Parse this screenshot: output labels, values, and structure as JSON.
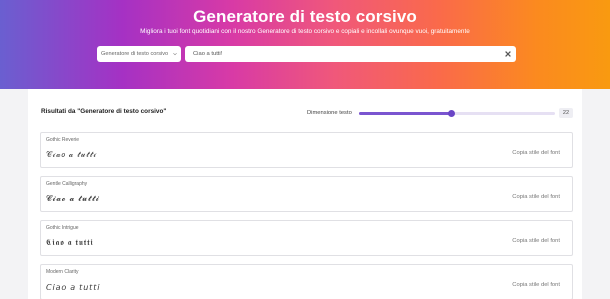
{
  "hero": {
    "title": "Generatore di testo corsivo",
    "subtitle": "Migliora i tuoi font quotidiani con il nostro Generatore di testo corsivo e copiali e incollali ovunque vuoi, gratuitamente"
  },
  "dropdown": {
    "selected": "Generatore di testo corsivo"
  },
  "search": {
    "value": "Ciao a tutti!"
  },
  "results": {
    "title": "Risultati da \"Generatore di testo corsivo\"",
    "size_label": "Dimensione testo",
    "size_value": "22",
    "slider_fraction": 0.47
  },
  "cards": [
    {
      "name": "Gothic Reverie",
      "sample": "𝒞𝒾𝒶𝑜 𝒶 𝓉𝓊𝓉𝓉𝒾",
      "copy": "Copia stile del font"
    },
    {
      "name": "Gentle Calligraphy",
      "sample": "𝓒𝓲𝓪𝓸 𝓪 𝓽𝓾𝓽𝓽𝓲",
      "copy": "Copia stile del font"
    },
    {
      "name": "Gothic Intrigue",
      "sample": "𝕮𝖎𝖆𝖔 𝖆 𝖙𝖚𝖙𝖙𝖎",
      "copy": "Copia stile del font"
    },
    {
      "name": "Modern Clarity",
      "sample": "𝘊𝘪𝘢𝘰 𝘢 𝘵𝘶𝘵𝘵𝘪",
      "copy": "Copia stile del font"
    }
  ]
}
